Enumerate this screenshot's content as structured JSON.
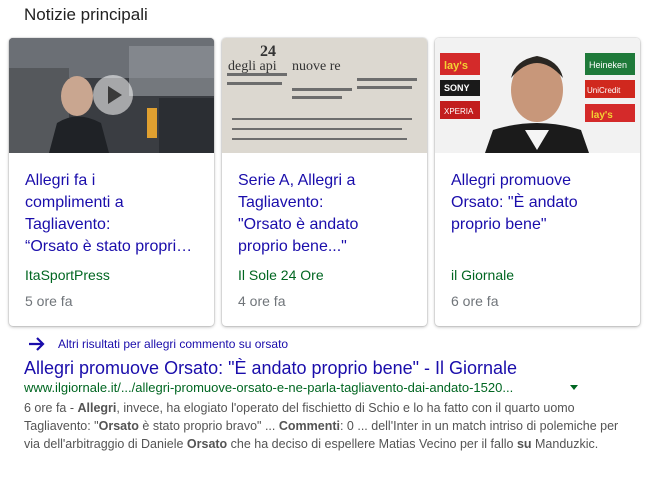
{
  "section_title": "Notizie principali",
  "cards": [
    {
      "title_lines": [
        "Allegri fa i",
        "complimenti a",
        "Tagliavento:",
        "“Orsato è stato propri…"
      ],
      "source": "ItaSportPress",
      "time": "5 ore fa",
      "thumb_icon": "video-play-icon"
    },
    {
      "title_lines": [
        "Serie A, Allegri a",
        "Tagliavento:",
        "\"Orsato è andato",
        "proprio bene...\""
      ],
      "source": "Il Sole 24 Ore",
      "time": "4 ore fa",
      "thumb_text": [
        "24",
        "degli api",
        "nuove re"
      ]
    },
    {
      "title_lines": [
        "Allegri promuove",
        "Orsato: \"È andato",
        "proprio bene\""
      ],
      "source": "il Giornale",
      "time": "6 ore fa",
      "thumb_text": [
        "lay's",
        "SONY",
        "XPERIA",
        "Heineken",
        "UniCredit",
        "lay's"
      ]
    }
  ],
  "more_results": {
    "icon": "arrow-right-icon",
    "prefix": "Altri risultati per ",
    "query": "allegri commento su orsato"
  },
  "result": {
    "title": "Allegri promuove Orsato: \"È andato proprio bene\" - Il Giornale",
    "url": "www.ilgiornale.it/.../allegri-promuove-orsato-e-ne-parla-tagliavento-dai-andato-1520...",
    "snippet_parts": [
      {
        "t": "6 ore fa - ",
        "b": false
      },
      {
        "t": "Allegri",
        "b": true
      },
      {
        "t": ", invece, ha elogiato l'operato del fischietto di Schio e lo ha fatto con il quarto uomo Tagliavento: \"",
        "b": false
      },
      {
        "t": "Orsato",
        "b": true
      },
      {
        "t": " è stato proprio bravo\" ... ",
        "b": false
      },
      {
        "t": "Commenti",
        "b": true
      },
      {
        "t": ": 0 ... dell'Inter in un match intriso di polemiche per via dell'arbitraggio di Daniele ",
        "b": false
      },
      {
        "t": "Orsato",
        "b": true
      },
      {
        "t": " che ha deciso di espellere Matias Vecino per il fallo ",
        "b": false
      },
      {
        "t": "su",
        "b": true
      },
      {
        "t": " Manduzkic.",
        "b": false
      }
    ]
  },
  "colors": {
    "link": "#1a0dab",
    "source_green": "#006621",
    "meta_grey": "#70757a",
    "snippet_grey": "#545454"
  }
}
